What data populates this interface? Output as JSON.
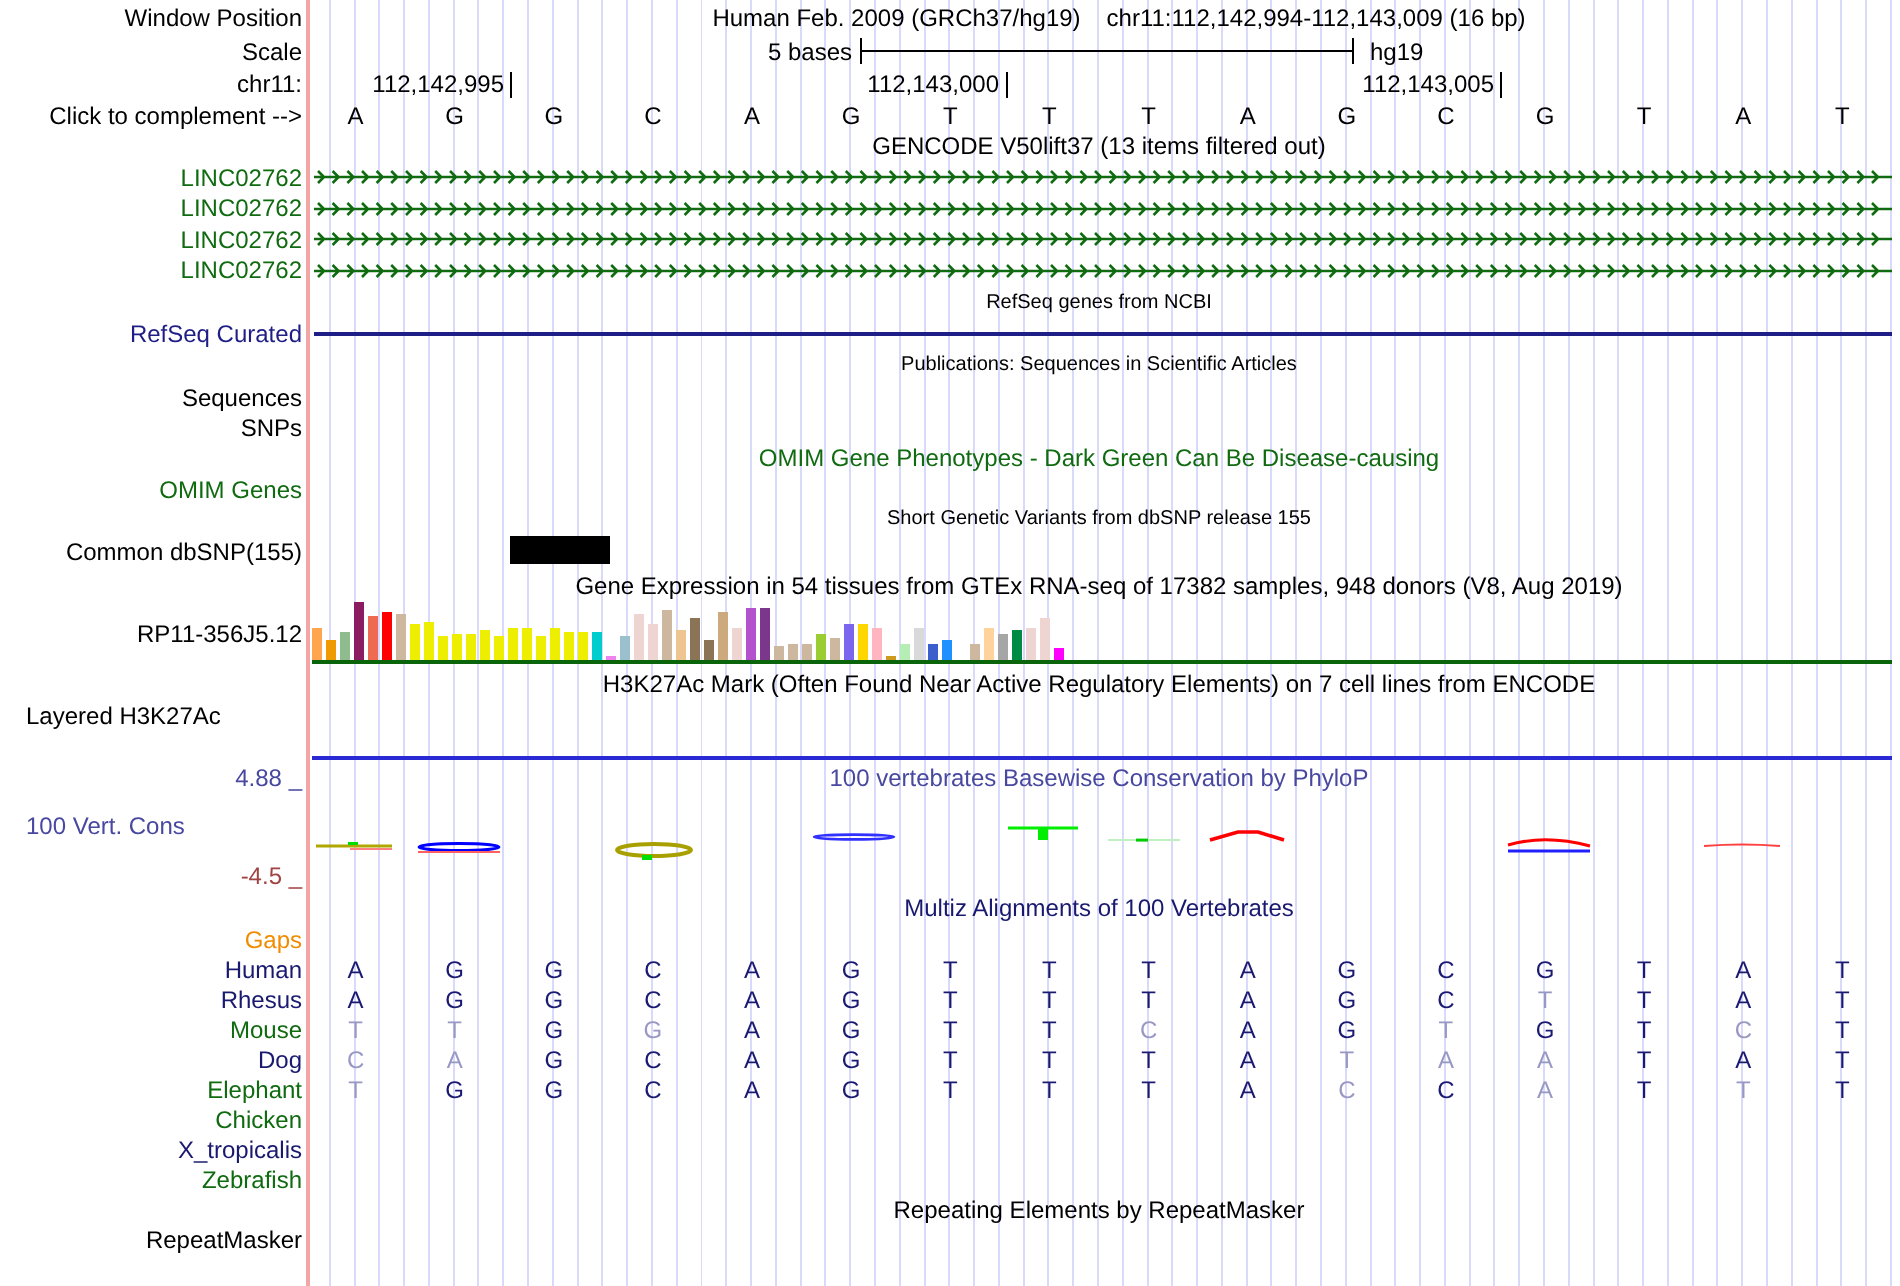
{
  "position": {
    "label": "Window Position",
    "assembly": "Human Feb. 2009 (GRCh37/hg19)",
    "region": "chr11:112,142,994-112,143,009 (16 bp)"
  },
  "scale": {
    "label": "Scale",
    "span": "5 bases",
    "assembly": "hg19"
  },
  "ruler": {
    "label": "chr11:",
    "ticks": [
      "112,142,995",
      "112,143,000",
      "112,143,005"
    ]
  },
  "sequence": {
    "label": "Click to complement -->",
    "bases": [
      "A",
      "G",
      "G",
      "C",
      "A",
      "G",
      "T",
      "T",
      "T",
      "A",
      "G",
      "C",
      "G",
      "T",
      "A",
      "T"
    ]
  },
  "tracks": [
    {
      "kind": "genes",
      "title": "GENCODE V50lift37 (13 items filtered out)",
      "color": "#106b10",
      "items": [
        {
          "label": "LINC02762"
        },
        {
          "label": "LINC02762"
        },
        {
          "label": "LINC02762"
        },
        {
          "label": "LINC02762"
        }
      ]
    },
    {
      "kind": "refseq",
      "title": "RefSeq genes from NCBI",
      "label": "RefSeq Curated",
      "color": "#1e1e86"
    },
    {
      "kind": "publications",
      "title": "Publications: Sequences in Scientific Articles",
      "labels": [
        "Sequences",
        "SNPs"
      ]
    },
    {
      "kind": "omim",
      "title": "OMIM Gene Phenotypes - Dark Green Can Be Disease-causing",
      "color": "#106b10",
      "labels": [
        "OMIM Genes"
      ]
    },
    {
      "kind": "variants",
      "title": "Short Genetic Variants from dbSNP release 155",
      "label": "Common dbSNP(155)"
    },
    {
      "kind": "expression",
      "title": "Gene Expression in 54 tissues from GTEx RNA-seq of 17382 samples, 948 donors (V8, Aug 2019)",
      "label": "RP11-356J5.12"
    },
    {
      "kind": "signal",
      "title": "H3K27Ac Mark (Often Found Near Active Regulatory Elements) on 7 cell lines from ENCODE",
      "label": "Layered H3K27Ac"
    },
    {
      "kind": "conservation",
      "title": "100 vertebrates Basewise Conservation by PhyloP",
      "color": "#4848a0",
      "label": "100 Vert. Cons",
      "max": "4.88 _",
      "min": "-4.5 _"
    },
    {
      "kind": "alignment",
      "title": "Multiz Alignments of 100 Vertebrates",
      "color": "#191970",
      "gaps": {
        "label": "Gaps",
        "color": "#f08c00"
      },
      "species": [
        {
          "name": "Human",
          "color": "#191970",
          "bases": [
            {
              "base": "A",
              "differs": false
            },
            {
              "base": "G",
              "differs": false
            },
            {
              "base": "G",
              "differs": false
            },
            {
              "base": "C",
              "differs": false
            },
            {
              "base": "A",
              "differs": false
            },
            {
              "base": "G",
              "differs": false
            },
            {
              "base": "T",
              "differs": false
            },
            {
              "base": "T",
              "differs": false
            },
            {
              "base": "T",
              "differs": false
            },
            {
              "base": "A",
              "differs": false
            },
            {
              "base": "G",
              "differs": false
            },
            {
              "base": "C",
              "differs": false
            },
            {
              "base": "G",
              "differs": false
            },
            {
              "base": "T",
              "differs": false
            },
            {
              "base": "A",
              "differs": false
            },
            {
              "base": "T",
              "differs": false
            }
          ]
        },
        {
          "name": "Rhesus",
          "color": "#191970",
          "bases": [
            {
              "base": "A",
              "differs": false
            },
            {
              "base": "G",
              "differs": false
            },
            {
              "base": "G",
              "differs": false
            },
            {
              "base": "C",
              "differs": false
            },
            {
              "base": "A",
              "differs": false
            },
            {
              "base": "G",
              "differs": false
            },
            {
              "base": "T",
              "differs": false
            },
            {
              "base": "T",
              "differs": false
            },
            {
              "base": "T",
              "differs": false
            },
            {
              "base": "A",
              "differs": false
            },
            {
              "base": "G",
              "differs": false
            },
            {
              "base": "C",
              "differs": false
            },
            {
              "base": "T",
              "differs": true
            },
            {
              "base": "T",
              "differs": false
            },
            {
              "base": "A",
              "differs": false
            },
            {
              "base": "T",
              "differs": false
            }
          ]
        },
        {
          "name": "Mouse",
          "color": "#106b10",
          "bases": [
            {
              "base": "T",
              "differs": true
            },
            {
              "base": "T",
              "differs": true
            },
            {
              "base": "G",
              "differs": false
            },
            {
              "base": "G",
              "differs": true
            },
            {
              "base": "A",
              "differs": false
            },
            {
              "base": "G",
              "differs": false
            },
            {
              "base": "T",
              "differs": false
            },
            {
              "base": "T",
              "differs": false
            },
            {
              "base": "C",
              "differs": true
            },
            {
              "base": "A",
              "differs": false
            },
            {
              "base": "G",
              "differs": false
            },
            {
              "base": "T",
              "differs": true
            },
            {
              "base": "G",
              "differs": false
            },
            {
              "base": "T",
              "differs": false
            },
            {
              "base": "C",
              "differs": true
            },
            {
              "base": "T",
              "differs": false
            }
          ]
        },
        {
          "name": "Dog",
          "color": "#191970",
          "bases": [
            {
              "base": "C",
              "differs": true
            },
            {
              "base": "A",
              "differs": true
            },
            {
              "base": "G",
              "differs": false
            },
            {
              "base": "C",
              "differs": false
            },
            {
              "base": "A",
              "differs": false
            },
            {
              "base": "G",
              "differs": false
            },
            {
              "base": "T",
              "differs": false
            },
            {
              "base": "T",
              "differs": false
            },
            {
              "base": "T",
              "differs": false
            },
            {
              "base": "A",
              "differs": false
            },
            {
              "base": "T",
              "differs": true
            },
            {
              "base": "A",
              "differs": true
            },
            {
              "base": "A",
              "differs": true
            },
            {
              "base": "T",
              "differs": false
            },
            {
              "base": "A",
              "differs": false
            },
            {
              "base": "T",
              "differs": false
            }
          ]
        },
        {
          "name": "Elephant",
          "color": "#106b10",
          "bases": [
            {
              "base": "T",
              "differs": true
            },
            {
              "base": "G",
              "differs": false
            },
            {
              "base": "G",
              "differs": false
            },
            {
              "base": "C",
              "differs": false
            },
            {
              "base": "A",
              "differs": false
            },
            {
              "base": "G",
              "differs": false
            },
            {
              "base": "T",
              "differs": false
            },
            {
              "base": "T",
              "differs": false
            },
            {
              "base": "T",
              "differs": false
            },
            {
              "base": "A",
              "differs": false
            },
            {
              "base": "C",
              "differs": true
            },
            {
              "base": "C",
              "differs": false
            },
            {
              "base": "A",
              "differs": true
            },
            {
              "base": "T",
              "differs": false
            },
            {
              "base": "T",
              "differs": true
            },
            {
              "base": "T",
              "differs": false
            }
          ]
        },
        {
          "name": "Chicken",
          "color": "#106b10"
        },
        {
          "name": "X_tropicalis",
          "color": "#191970"
        },
        {
          "name": "Zebrafish",
          "color": "#106b10"
        }
      ]
    },
    {
      "kind": "repeats",
      "title": "Repeating Elements by RepeatMasker",
      "label": "RepeatMasker"
    }
  ]
}
